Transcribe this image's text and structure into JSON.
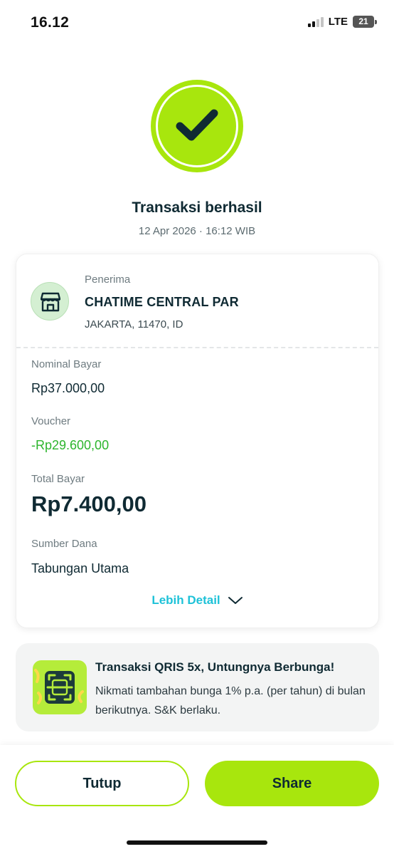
{
  "status_bar": {
    "time": "16.12",
    "network": "LTE",
    "battery": "21"
  },
  "header": {
    "title": "Transaksi berhasil",
    "datetime": "12 Apr 2026 · 16:12 WIB"
  },
  "recipient": {
    "label": "Penerima",
    "name": "CHATIME CENTRAL PAR",
    "location": "JAKARTA, 11470, ID"
  },
  "details": {
    "nominal_label": "Nominal Bayar",
    "nominal_value": "Rp37.000,00",
    "voucher_label": "Voucher",
    "voucher_value": "-Rp29.600,00",
    "total_label": "Total Bayar",
    "total_value": "Rp7.400,00",
    "source_label": "Sumber Dana",
    "source_value": "Tabungan Utama",
    "more_label": "Lebih Detail"
  },
  "promo": {
    "title": "Transaksi QRIS 5x, Untungnya Berbunga!",
    "text": "Nikmati tambahan bunga 1% p.a. (per tahun) di bulan berikutnya. S&K berlaku."
  },
  "actions": {
    "close_label": "Tutup",
    "share_label": "Share"
  },
  "colors": {
    "accent": "#a8e60d",
    "link": "#1ec2d8",
    "discount": "#2db52d",
    "text": "#0f2a33"
  }
}
